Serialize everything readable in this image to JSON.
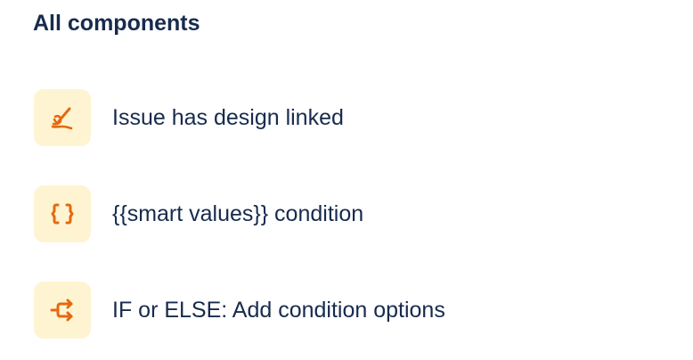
{
  "heading": "All components",
  "accent_color": "#e56910",
  "tile_color": "#fff4d1",
  "components": [
    {
      "label": "Issue has design linked",
      "icon": "brush-icon"
    },
    {
      "label": "{{smart values}} condition",
      "icon": "curly-braces-icon"
    },
    {
      "label": "IF or ELSE: Add condition options",
      "icon": "branch-icon"
    }
  ]
}
